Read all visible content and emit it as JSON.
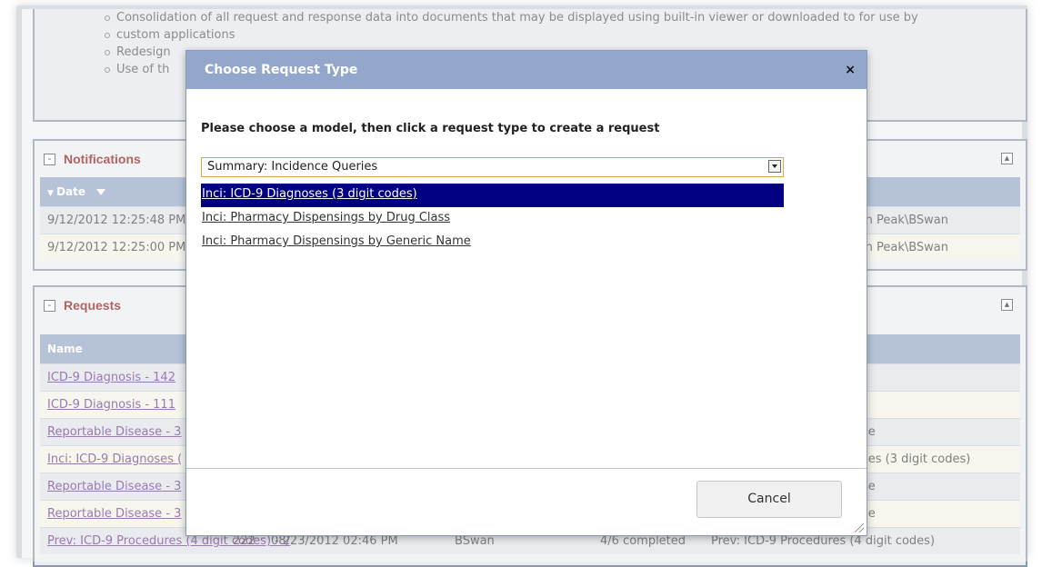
{
  "top_panel": {
    "bullets": [
      "Consolidation of all request and response data into documents that may be displayed using built-in viewer or downloaded to for use by",
      "custom applications",
      "Redesign",
      "Use of th"
    ]
  },
  "notifications": {
    "title": "Notifications",
    "toggle": "-",
    "collapse": "▲",
    "column_header": "Date",
    "rows": [
      {
        "date": "9/12/2012 12:25:48 PM",
        "right": "ln Peak\\BSwan"
      },
      {
        "date": "9/12/2012 12:25:00 PM",
        "right": "ln Peak\\BSwan"
      }
    ]
  },
  "requests": {
    "title": "Requests",
    "toggle": "-",
    "collapse": "▲",
    "column_header": "Name",
    "rows": [
      {
        "name": "ICD-9 Diagnosis - 142",
        "right": ""
      },
      {
        "name": "ICD-9 Diagnosis - 111",
        "right": ""
      },
      {
        "name": "Reportable Disease - 3",
        "right": "se"
      },
      {
        "name": "Inci: ICD-9 Diagnoses (",
        "right": "ses (3 digit codes)"
      },
      {
        "name": "Reportable Disease - 3",
        "right": "se"
      },
      {
        "name": "Reportable Disease - 3",
        "right": "se"
      }
    ],
    "last_row": {
      "name": "Prev: ICD-9 Procedures (4 digit codes) - 2",
      "id": "222",
      "date": "08/23/2012 02:46 PM",
      "user": "BSwan",
      "status": "4/6 completed",
      "type": "Prev: ICD-9 Procedures (4 digit codes)"
    }
  },
  "modal": {
    "title": "Choose Request Type",
    "close": "×",
    "instruction": "Please choose a model, then click a request type to create a request",
    "selected_model": "Summary: Incidence Queries",
    "options": [
      "Inci: ICD-9 Diagnoses (3 digit codes)",
      "Inci: Pharmacy Dispensings by Drug Class",
      "Inci: Pharmacy Dispensings by Generic Name"
    ],
    "cancel_label": "Cancel"
  },
  "colors": {
    "header_bar": "#93a6cb",
    "selected_option": "#000080",
    "panel_title": "#8a1818"
  }
}
